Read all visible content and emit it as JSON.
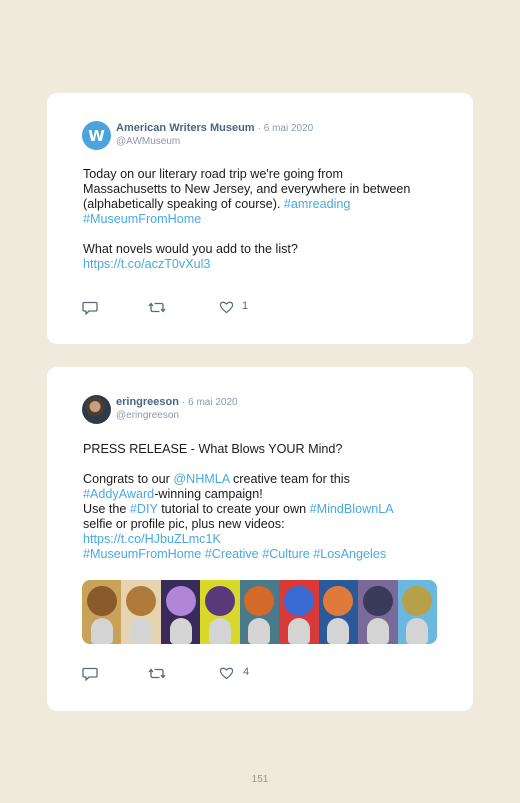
{
  "posts": [
    {
      "author_name": "American Writers Museum",
      "date": "· 6 mai 2020",
      "handle": "@AWMuseum",
      "avatar_letter": "W",
      "body": {
        "line1": "Today on our literary road trip we're going from",
        "line2": "Massachusetts to New Jersey, and everywhere in between",
        "line3_text": "(alphabetically speaking of course).",
        "line3_tag": "#amreading",
        "line4_tag": "#MuseumFromHome",
        "line5": "What novels would you add to the list?",
        "link": "https://t.co/aczT0vXul3"
      },
      "like_count": "1",
      "icons": [
        "reply-icon",
        "retweet-icon",
        "heart-icon"
      ]
    },
    {
      "author_name": "eringreeson",
      "date": "· 6 mai 2020",
      "handle": "@eringreeson",
      "body": {
        "line1": "PRESS RELEASE - What Blows YOUR Mind?",
        "line2_pre": "Congrats to our",
        "line2_mention": "@NHMLA",
        "line2_post": "creative team for this",
        "line3_tag": "#AddyAward",
        "line3_post": "-winning campaign!",
        "line4_pre": "Use the",
        "line4_tag": "#DIY",
        "line4_mid": "tutorial to create your own",
        "line4_tag2": "#MindBlownLA",
        "line5": "selfie or profile pic, plus new videos:",
        "link": "https://t.co/HJbuZLmc1K",
        "tags": [
          "#MuseumFromHome",
          "#Creative",
          "#Culture",
          "#LosAngeles"
        ]
      },
      "like_count": "4",
      "icons": [
        "reply-icon",
        "retweet-icon",
        "heart-icon"
      ]
    }
  ],
  "page_number": "151",
  "colors": {
    "background": "#efeadc",
    "card": "#ffffff",
    "name": "#4a6684",
    "link": "#4aa8df",
    "muted": "#8c9aa8"
  }
}
